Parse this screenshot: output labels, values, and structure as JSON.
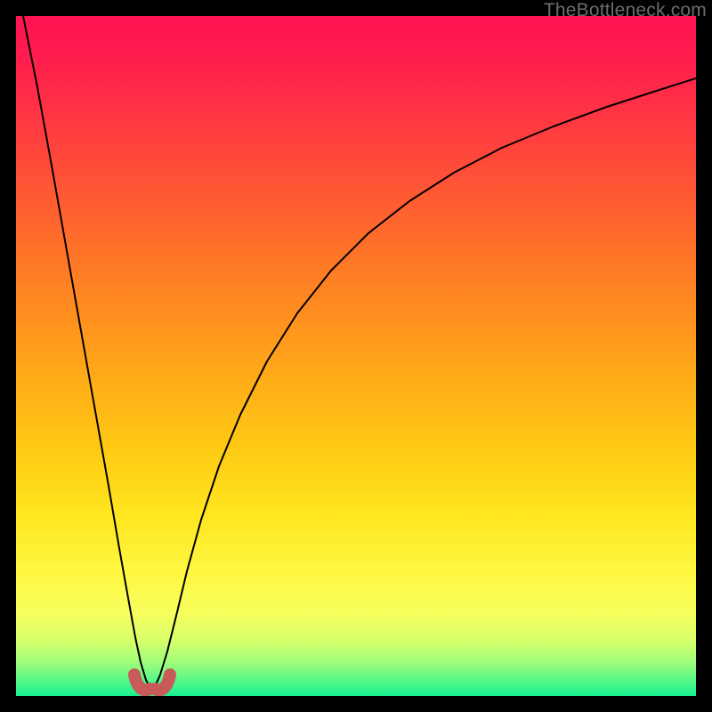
{
  "watermark": "TheBottleneck.com",
  "chart_data": {
    "type": "line",
    "title": "",
    "xlabel": "",
    "ylabel": "",
    "xlim": [
      0,
      100
    ],
    "ylim": [
      0,
      100
    ],
    "series": [
      {
        "name": "left-branch",
        "x": [
          1,
          3,
          5,
          7,
          9,
          11,
          13,
          15,
          16,
          17,
          18,
          18.8
        ],
        "values": [
          100,
          88,
          76,
          64,
          52,
          40,
          28,
          16,
          10,
          5.5,
          2.5,
          1.2
        ]
      },
      {
        "name": "right-branch",
        "x": [
          21,
          22,
          23,
          25,
          28,
          32,
          37,
          43,
          50,
          58,
          67,
          77,
          88,
          100
        ],
        "values": [
          1.2,
          3,
          6,
          12,
          22,
          34,
          46,
          57,
          66,
          74,
          80,
          85,
          89,
          92
        ]
      }
    ],
    "annotations": [
      {
        "name": "vertex-marker",
        "x_range": [
          17.2,
          22.0
        ],
        "y_range": [
          0.2,
          3.2
        ],
        "shape": "u-lobe",
        "color": "#c85a5a"
      }
    ],
    "background": {
      "type": "vertical-gradient",
      "stops": [
        {
          "pos": 0.0,
          "color": "#ff1452"
        },
        {
          "pos": 0.45,
          "color": "#ff8f1f"
        },
        {
          "pos": 0.8,
          "color": "#fff842"
        },
        {
          "pos": 1.0,
          "color": "#17f191"
        }
      ]
    }
  }
}
